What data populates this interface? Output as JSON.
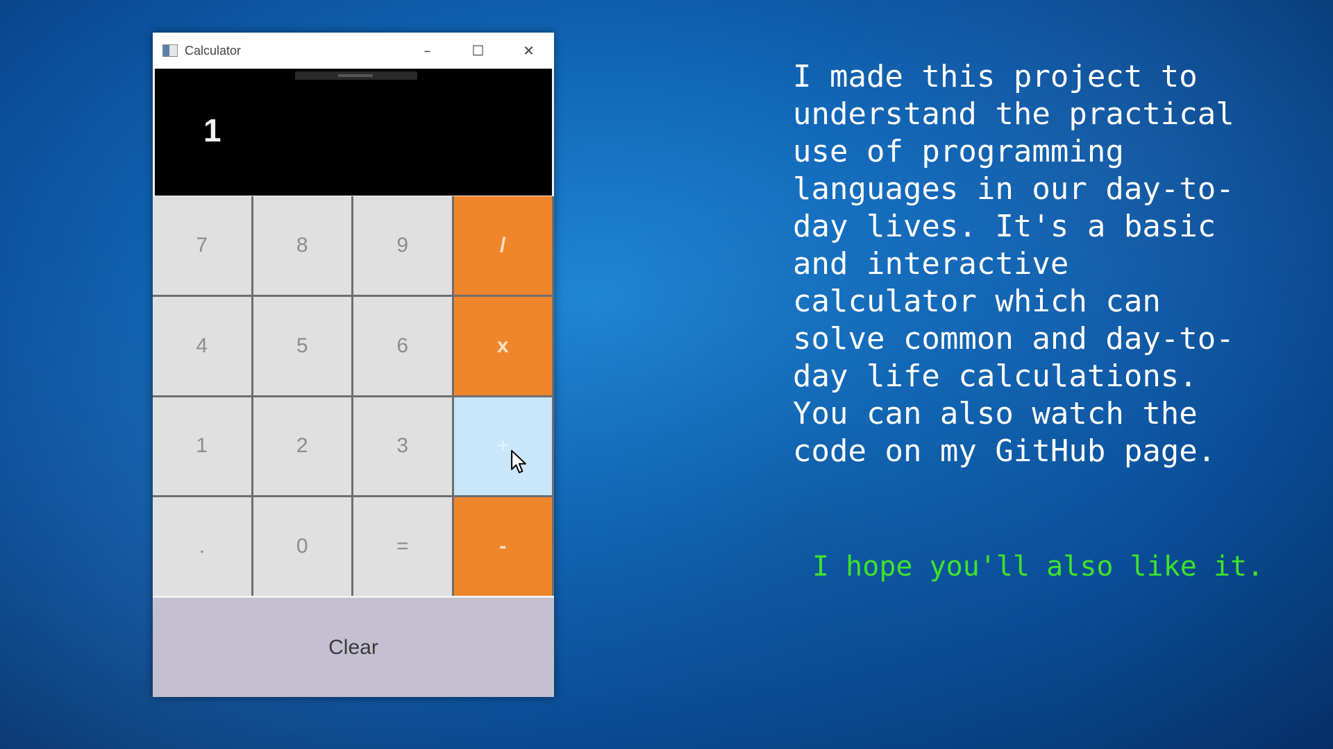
{
  "window": {
    "title": "Calculator",
    "controls": {
      "minimize": "–",
      "maximize": "☐",
      "close": "✕"
    }
  },
  "display": {
    "value": "1"
  },
  "keypad": {
    "keys": [
      "7",
      "8",
      "9",
      "/",
      "4",
      "5",
      "6",
      "x",
      "1",
      "2",
      "3",
      "+",
      ".",
      "0",
      "=",
      "-"
    ],
    "clear": "Clear"
  },
  "description": {
    "lines": [
      "I made this project to",
      "understand the practical",
      "use of programming",
      "languages in our day-to-",
      "day lives. It's a basic",
      "and interactive",
      "calculator which can",
      "solve common and day-to-",
      "day life calculations.",
      "You can also watch the",
      "code on my GitHub page."
    ],
    "closing": "I hope you'll also like it."
  },
  "colors": {
    "operator": "#f0862c",
    "hover": "#c9e6fb",
    "closing_text": "#3fe22c",
    "background": "#1268b8"
  }
}
